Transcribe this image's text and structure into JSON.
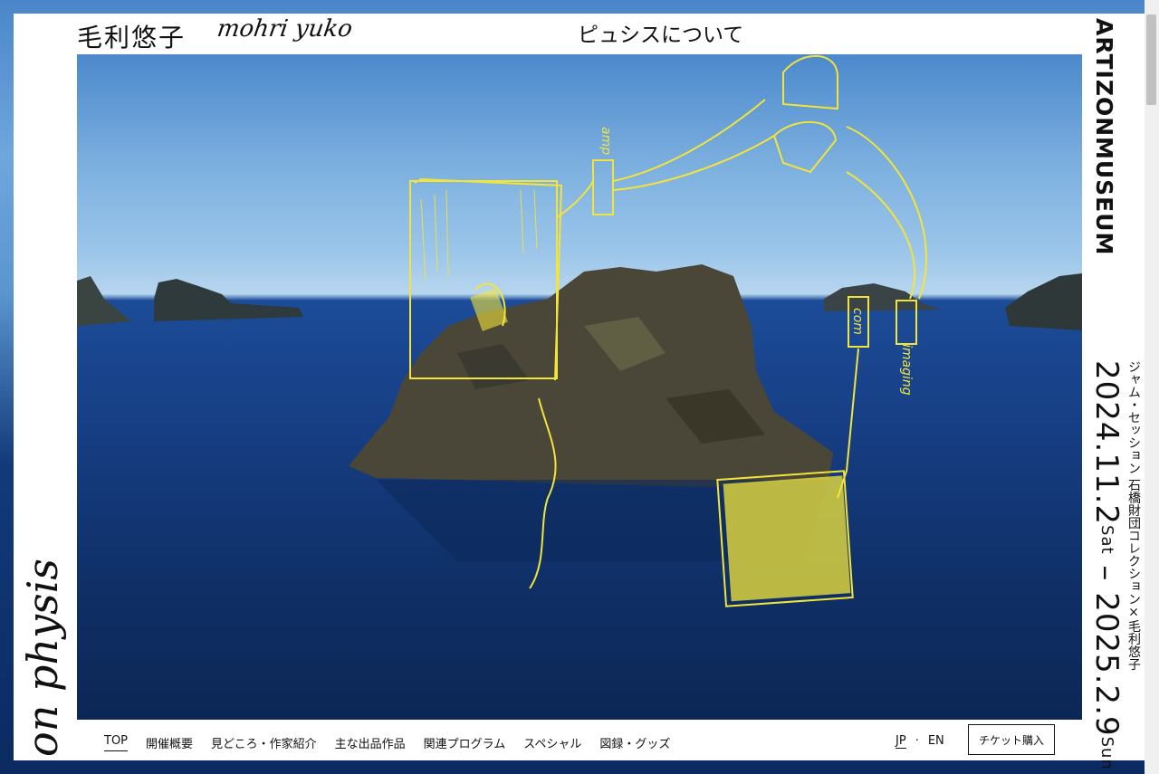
{
  "header": {
    "artist_jp": "毛利悠子",
    "artist_en": "mohri yuko",
    "about_link": "ピュシスについて"
  },
  "left_title": "on physis",
  "museum": {
    "line1": "ARTIZON",
    "line2": "MUSEUM"
  },
  "exhibition": {
    "subtitle": "ジャム・セッション 石橋財団コレクション×毛利悠子",
    "start_date": "2024.11.2",
    "start_day": "Sat",
    "separator": " – ",
    "end_date": "2025.2.9",
    "end_day": "Sun"
  },
  "nav": {
    "items": [
      "TOP",
      "開催概要",
      "見どころ・作家紹介",
      "主な出品作品",
      "関連プログラム",
      "スペシャル",
      "図録・グッズ"
    ]
  },
  "lang": {
    "jp": "JP",
    "sep": "·",
    "en": "EN"
  },
  "ticket_button": "チケット購入",
  "sketch_labels": {
    "amp": "amp",
    "com": "com",
    "imaging": "imaging"
  },
  "colors": {
    "sketch_yellow": "#f2e43a",
    "sea": "#173f85",
    "sky": "#9cc6ea"
  }
}
